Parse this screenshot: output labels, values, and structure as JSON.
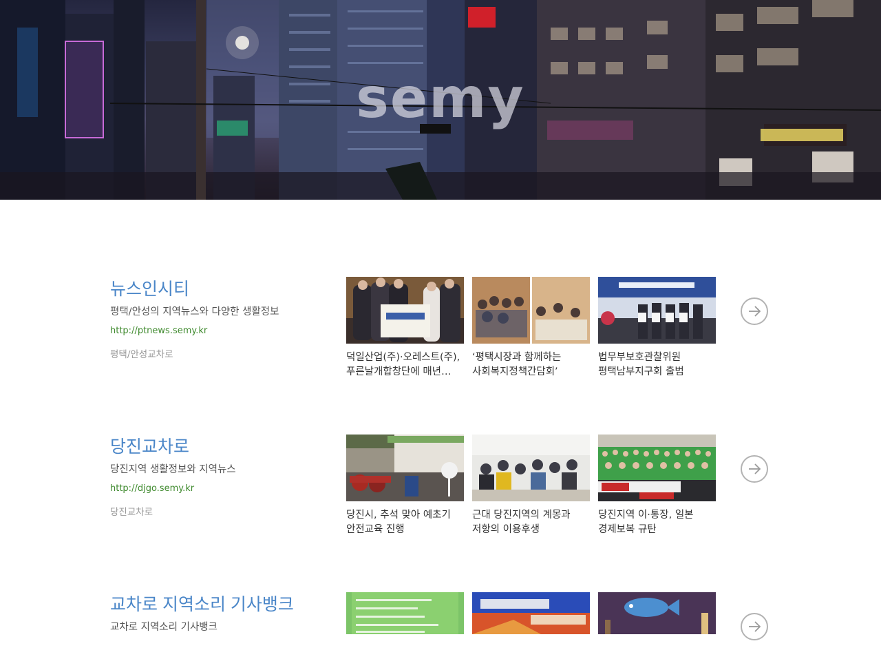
{
  "hero": {
    "title": "semy"
  },
  "sites": [
    {
      "name": "뉴스인시티",
      "description": "평택/안성의 지역뉴스와 다양한 생활정보",
      "url": "http://ptnews.semy.kr",
      "category": "평택/안성교차로",
      "articles": [
        {
          "title": "덕일산업(주)·오레스트(주), 푸른날개합창단에 매년…"
        },
        {
          "title": "‘평택시장과 함께하는 사회복지정책간담회’"
        },
        {
          "title": "법무부보호관찰위원 평택남부지구회 출범"
        }
      ],
      "next_icon": "arrow-right-circle-icon"
    },
    {
      "name": "당진교차로",
      "description": "당진지역 생활정보와 지역뉴스",
      "url": "http://djgo.semy.kr",
      "category": "당진교차로",
      "articles": [
        {
          "title": "당진시, 추석 맞아 예초기 안전교육 진행"
        },
        {
          "title": "근대 당진지역의 계몽과 저항의 이용후생"
        },
        {
          "title": "당진지역 이·통장, 일본 경제보복 규탄"
        }
      ],
      "next_icon": "arrow-right-circle-icon"
    },
    {
      "name": "교차로 지역소리 기사뱅크",
      "description": "교차로 지역소리 기사뱅크",
      "url": "",
      "category": "",
      "articles": [
        {
          "title": ""
        },
        {
          "title": ""
        },
        {
          "title": ""
        }
      ],
      "next_icon": "arrow-right-circle-icon"
    }
  ]
}
